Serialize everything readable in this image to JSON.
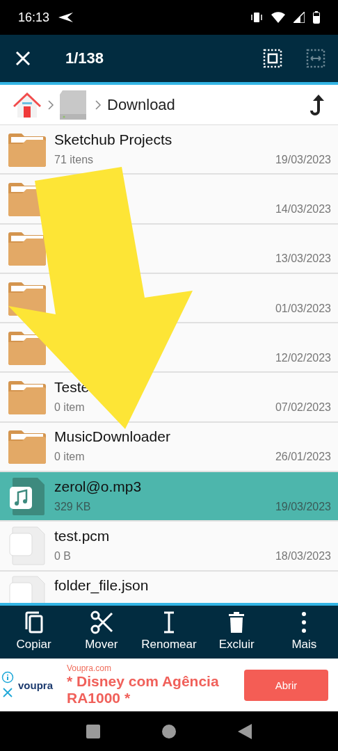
{
  "status_bar": {
    "time": "16:13"
  },
  "app_bar": {
    "counter": "1/138"
  },
  "breadcrumb": {
    "current": "Download"
  },
  "files": [
    {
      "kind": "folder",
      "name": "Sketchub Projects",
      "info": "71 itens",
      "date": "19/03/2023",
      "selected": false
    },
    {
      "kind": "folder",
      "date": "14/03/2023",
      "selected": false
    },
    {
      "kind": "folder",
      "date": "13/03/2023",
      "selected": false
    },
    {
      "kind": "folder",
      "date": "01/03/2023",
      "selected": false
    },
    {
      "kind": "folder",
      "date": "12/02/2023",
      "selected": false
    },
    {
      "kind": "folder",
      "name": "Teste",
      "info": "0 item",
      "date": "07/02/2023",
      "selected": false
    },
    {
      "kind": "folder",
      "name": "MusicDownloader",
      "info": "0 item",
      "date": "26/01/2023",
      "selected": false
    },
    {
      "kind": "audio",
      "name": "zerol@o.mp3",
      "info": "329 KB",
      "date": "19/03/2023",
      "selected": true
    },
    {
      "kind": "file",
      "name": "test.pcm",
      "info": "0 B",
      "date": "18/03/2023",
      "selected": false
    },
    {
      "kind": "file",
      "name": "folder_file.json",
      "selected": false
    }
  ],
  "actions": [
    {
      "kind": "copy",
      "label": "Copiar"
    },
    {
      "kind": "move",
      "label": "Mover"
    },
    {
      "kind": "rename",
      "label": "Renomear"
    },
    {
      "kind": "delete",
      "label": "Excluir"
    },
    {
      "kind": "more",
      "label": "Mais"
    }
  ],
  "ad": {
    "brand": "voupra",
    "site": "Voupra.com",
    "headline": "* Disney com Agência RA1000 *",
    "button": "Abrir"
  }
}
